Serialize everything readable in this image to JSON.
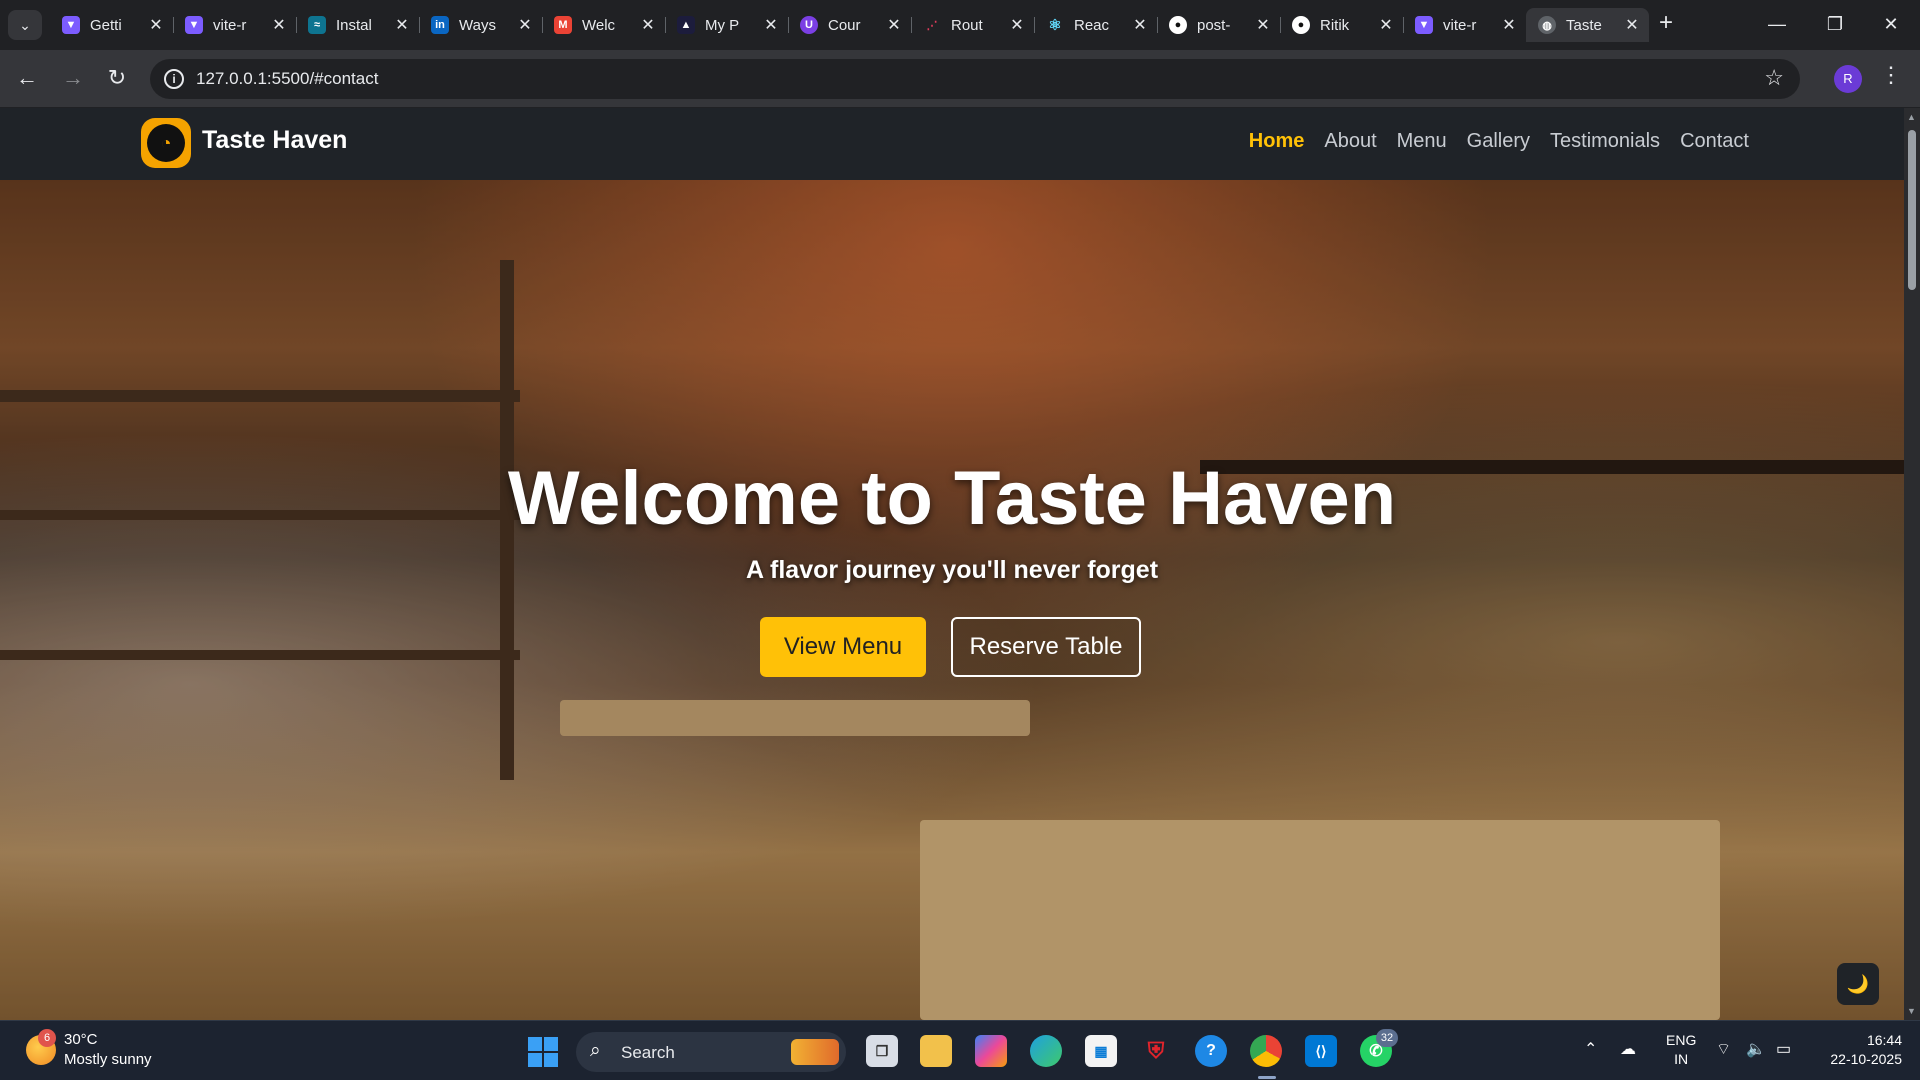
{
  "browser": {
    "tabs": [
      {
        "title": "Getti",
        "favicon_color": "#7c5cff",
        "icon": "vite-icon"
      },
      {
        "title": "vite-r",
        "favicon_color": "#7c5cff",
        "icon": "vite-icon"
      },
      {
        "title": "Instal",
        "favicon_color": "#38bdf8",
        "icon": "tailwind-icon"
      },
      {
        "title": "Ways",
        "favicon_color": "#0a66c2",
        "icon": "linkedin-icon"
      },
      {
        "title": "Welc",
        "favicon_color": "#ea4335",
        "icon": "gmail-icon"
      },
      {
        "title": "My P",
        "favicon_color": "#1c1c3c",
        "icon": "site-icon"
      },
      {
        "title": "Cour",
        "favicon_color": "#7b3fe4",
        "icon": "course-icon"
      },
      {
        "title": "Rout",
        "favicon_color": "#e03c5b",
        "icon": "router-icon"
      },
      {
        "title": "Reac",
        "favicon_color": "#61dafb",
        "icon": "react-icon"
      },
      {
        "title": "post-",
        "favicon_color": "#ffffff",
        "icon": "github-icon"
      },
      {
        "title": "Ritik",
        "favicon_color": "#ffffff",
        "icon": "github-icon"
      },
      {
        "title": "vite-r",
        "favicon_color": "#7c5cff",
        "icon": "vite-icon"
      },
      {
        "title": "Taste",
        "favicon_color": "#9aa0a6",
        "icon": "globe-icon",
        "active": true
      }
    ],
    "url": "127.0.0.1:5500/#contact",
    "profile_initial": "R"
  },
  "site": {
    "brand": "Taste Haven",
    "nav": [
      "Home",
      "About",
      "Menu",
      "Gallery",
      "Testimonials",
      "Contact"
    ],
    "active_nav": "Home",
    "hero": {
      "title": "Welcome to Taste Haven",
      "subtitle": "A flavor journey you'll never forget",
      "primary_button": "View Menu",
      "secondary_button": "Reserve Table"
    },
    "theme_toggle": "🌙",
    "accent": "#ffc107"
  },
  "taskbar": {
    "weather": {
      "temp": "30°C",
      "desc": "Mostly sunny",
      "badge": "6"
    },
    "search_label": "Search",
    "whatsapp_badge": "32",
    "lang_top": "ENG",
    "lang_bottom": "IN",
    "time": "16:44",
    "date": "22-10-2025"
  }
}
